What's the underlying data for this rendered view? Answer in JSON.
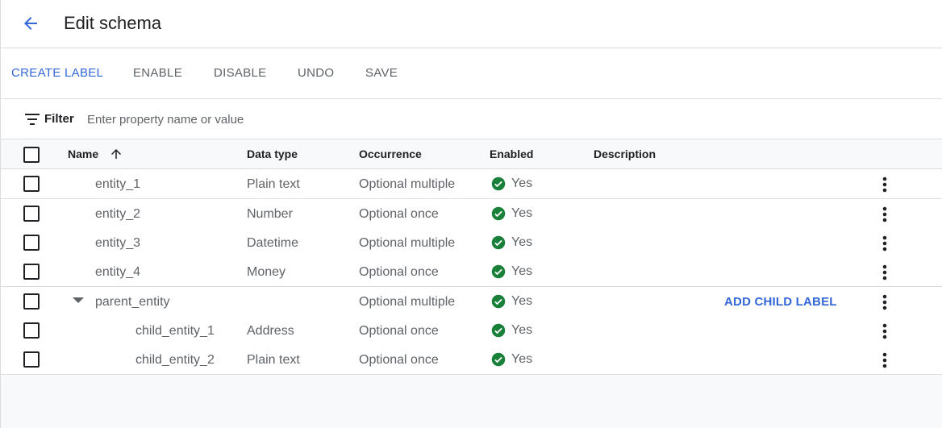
{
  "header": {
    "back_icon": "arrow-back-icon",
    "title": "Edit schema"
  },
  "toolbar": {
    "create_label": "CREATE LABEL",
    "enable_label": "ENABLE",
    "disable_label": "DISABLE",
    "undo_label": "UNDO",
    "save_label": "SAVE"
  },
  "filter": {
    "icon": "filter-list-icon",
    "label": "Filter",
    "placeholder": "Enter property name or value",
    "value": ""
  },
  "table": {
    "columns": {
      "name": "Name",
      "data_type": "Data type",
      "occurrence": "Occurrence",
      "enabled": "Enabled",
      "description": "Description"
    },
    "sort_icon": "arrow-upward-icon",
    "add_child_label": "ADD CHILD LABEL",
    "rows": [
      {
        "name": "entity_1",
        "data_type": "Plain text",
        "occurrence": "Optional multiple",
        "enabled": "Yes",
        "description": ""
      },
      {
        "name": "entity_2",
        "data_type": "Number",
        "occurrence": "Optional once",
        "enabled": "Yes",
        "description": ""
      },
      {
        "name": "entity_3",
        "data_type": "Datetime",
        "occurrence": "Optional multiple",
        "enabled": "Yes",
        "description": ""
      },
      {
        "name": "entity_4",
        "data_type": "Money",
        "occurrence": "Optional once",
        "enabled": "Yes",
        "description": ""
      },
      {
        "name": "parent_entity",
        "data_type": "",
        "occurrence": "Optional multiple",
        "enabled": "Yes",
        "description": ""
      },
      {
        "name": "child_entity_1",
        "data_type": "Address",
        "occurrence": "Optional once",
        "enabled": "Yes",
        "description": ""
      },
      {
        "name": "child_entity_2",
        "data_type": "Plain text",
        "occurrence": "Optional once",
        "enabled": "Yes",
        "description": ""
      }
    ]
  },
  "colors": {
    "accent": "#3367d6",
    "enabled_green": "#188038",
    "text_secondary": "#5f6368",
    "divider": "#dadce0"
  }
}
